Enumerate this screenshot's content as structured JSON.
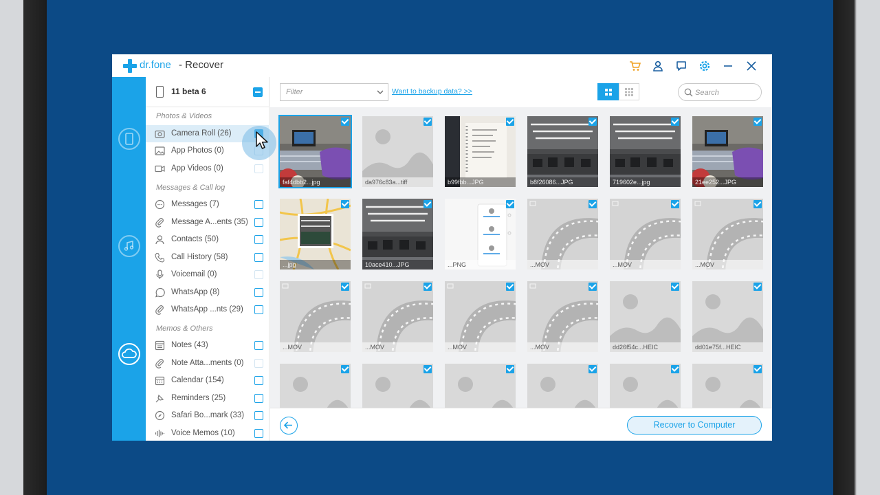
{
  "app": {
    "brand": "dr.fone",
    "title": "- Recover",
    "accent_color": "#1ba3e8",
    "icons": [
      "cart-icon",
      "user-icon",
      "feedback-icon",
      "settings-icon",
      "minimize-icon",
      "close-icon"
    ]
  },
  "rail": {
    "items": [
      "recover-from-device-icon",
      "recover-from-itunes-icon",
      "recover-from-icloud-icon"
    ]
  },
  "sidebar": {
    "device": "11 beta 6",
    "sections": [
      {
        "title": "Photos & Videos",
        "items": [
          {
            "label": "Camera Roll (26)",
            "icon": "camera-icon",
            "state": "checked"
          },
          {
            "label": "App Photos (0)",
            "icon": "image-icon",
            "state": "disabled"
          },
          {
            "label": "App Videos (0)",
            "icon": "video-icon",
            "state": "disabled"
          }
        ]
      },
      {
        "title": "Messages & Call log",
        "items": [
          {
            "label": "Messages (7)",
            "icon": "message-icon",
            "state": "unchecked"
          },
          {
            "label": "Message A...ents (35)",
            "icon": "paperclip-icon",
            "state": "unchecked"
          },
          {
            "label": "Contacts (50)",
            "icon": "contact-icon",
            "state": "unchecked"
          },
          {
            "label": "Call History (58)",
            "icon": "phone-icon",
            "state": "unchecked"
          },
          {
            "label": "Voicemail (0)",
            "icon": "voicemail-icon",
            "state": "disabled"
          },
          {
            "label": "WhatsApp (8)",
            "icon": "whatsapp-icon",
            "state": "unchecked"
          },
          {
            "label": "WhatsApp ...nts (29)",
            "icon": "paperclip-icon",
            "state": "unchecked"
          }
        ]
      },
      {
        "title": "Memos & Others",
        "items": [
          {
            "label": "Notes (43)",
            "icon": "notes-icon",
            "state": "unchecked"
          },
          {
            "label": "Note Atta...ments (0)",
            "icon": "paperclip-icon",
            "state": "disabled"
          },
          {
            "label": "Calendar (154)",
            "icon": "calendar-icon",
            "state": "unchecked"
          },
          {
            "label": "Reminders (25)",
            "icon": "reminder-icon",
            "state": "unchecked"
          },
          {
            "label": "Safari Bo...mark (33)",
            "icon": "safari-icon",
            "state": "unchecked"
          },
          {
            "label": "Voice Memos (10)",
            "icon": "voice-memo-icon",
            "state": "unchecked"
          }
        ]
      }
    ]
  },
  "toolbar": {
    "filter_placeholder": "Filter",
    "backup_link": "Want to backup data? >>",
    "search_placeholder": "Search"
  },
  "grid": {
    "items": [
      {
        "name": "faf4dbb2...jpg",
        "kind": "photo-desk",
        "selected": true
      },
      {
        "name": "da976c83a...tiff",
        "kind": "placeholder-image"
      },
      {
        "name": "b99fbb...JPG",
        "kind": "photo-notebook"
      },
      {
        "name": "b8f26086...JPG",
        "kind": "photo-office"
      },
      {
        "name": "719602e...jpg",
        "kind": "photo-office"
      },
      {
        "name": "21ee252...JPG",
        "kind": "photo-desk"
      },
      {
        "name": "...jpg",
        "kind": "photo-map"
      },
      {
        "name": "10ace410...JPG",
        "kind": "photo-office"
      },
      {
        "name": "...PNG",
        "kind": "photo-screenshot"
      },
      {
        "name": "...MOV",
        "kind": "video"
      },
      {
        "name": "...MOV",
        "kind": "video"
      },
      {
        "name": "...MOV",
        "kind": "video"
      },
      {
        "name": "...MOV",
        "kind": "video"
      },
      {
        "name": "...MOV",
        "kind": "video"
      },
      {
        "name": "...MOV",
        "kind": "video"
      },
      {
        "name": "...MOV",
        "kind": "video"
      },
      {
        "name": "dd26f54c...HEIC",
        "kind": "placeholder-image"
      },
      {
        "name": "dd01e75f...HEIC",
        "kind": "placeholder-image"
      },
      {
        "name": "",
        "kind": "placeholder-image"
      },
      {
        "name": "",
        "kind": "placeholder-image"
      },
      {
        "name": "",
        "kind": "placeholder-image"
      },
      {
        "name": "",
        "kind": "placeholder-image"
      },
      {
        "name": "",
        "kind": "placeholder-image"
      },
      {
        "name": "",
        "kind": "placeholder-image"
      }
    ]
  },
  "footer": {
    "recover_button": "Recover to Computer"
  }
}
